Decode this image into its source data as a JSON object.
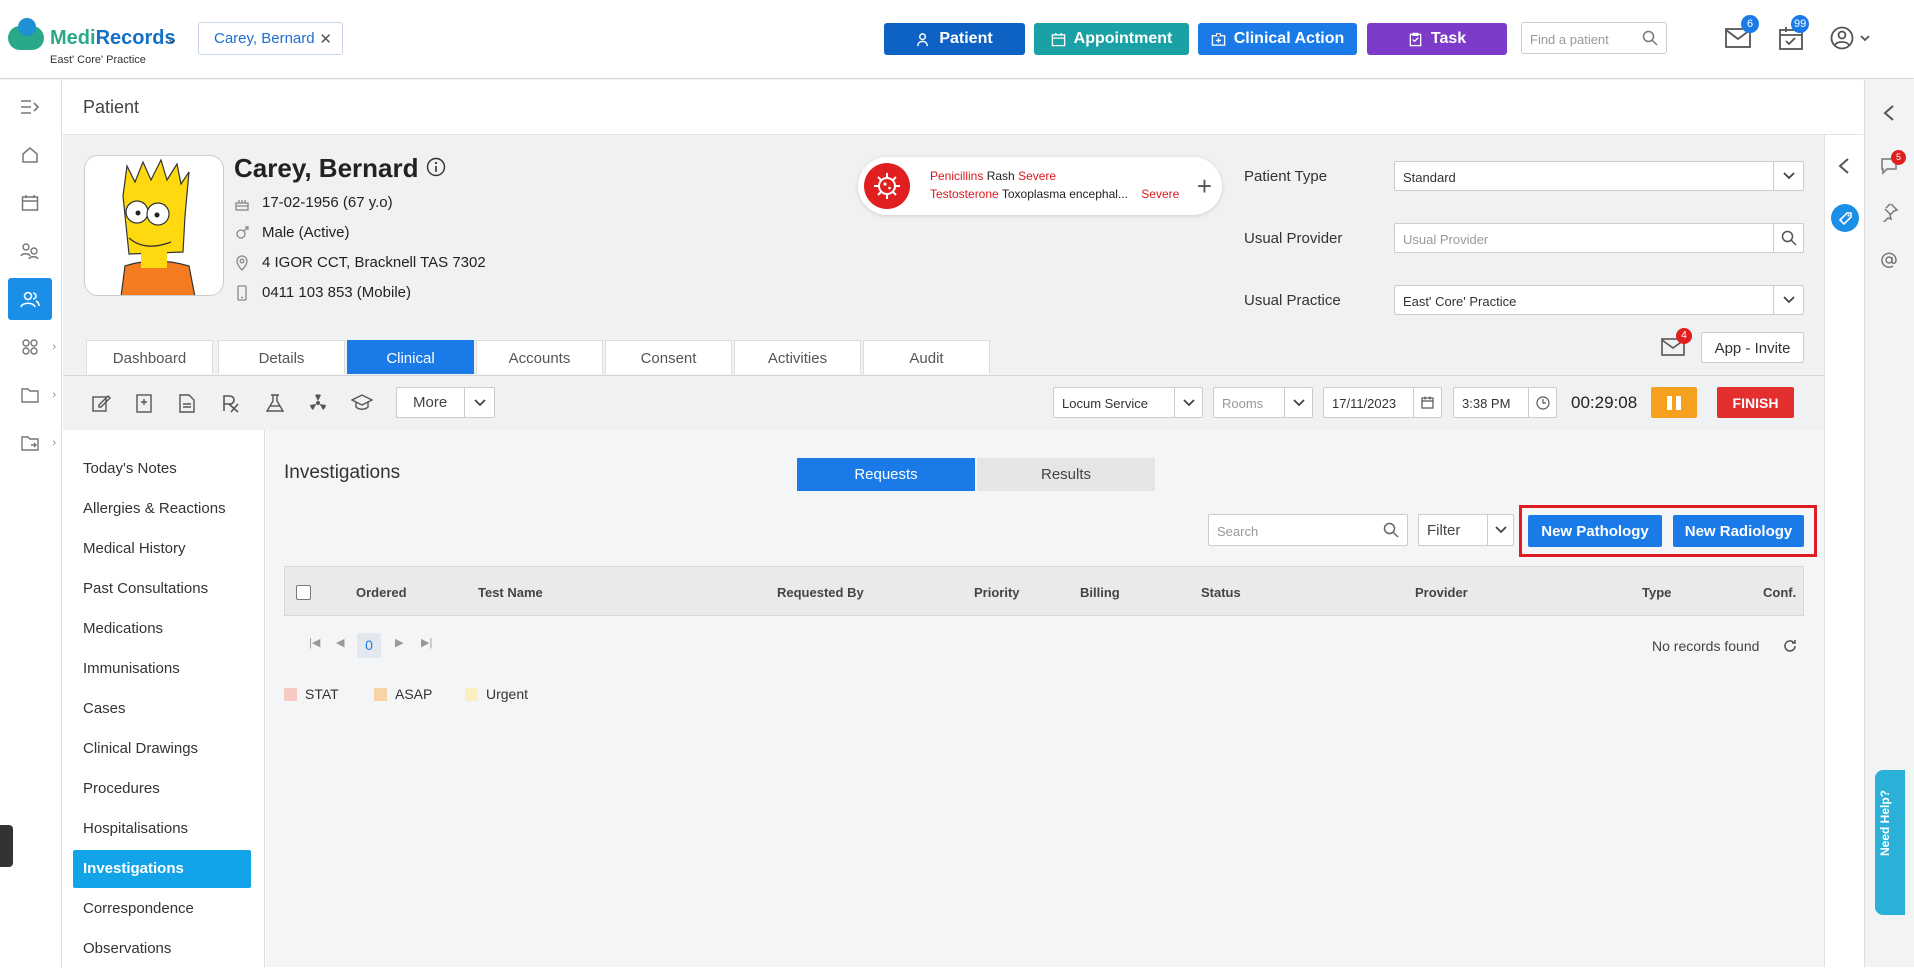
{
  "app": {
    "logo_part1": "Medi",
    "logo_part2": "Records",
    "practice": "East' Core' Practice"
  },
  "open_patient_chip": "Carey, Bernard",
  "top_buttons": {
    "patient": "Patient",
    "appointment": "Appointment",
    "clinical_action": "Clinical Action",
    "task": "Task"
  },
  "find_patient": {
    "placeholder": "Find a patient"
  },
  "badges": {
    "mail": "6",
    "calendar": "99",
    "side_chat": "5",
    "app_mail": "4"
  },
  "page_title": "Patient",
  "patient": {
    "name": "Carey, Bernard",
    "dob": "17-02-1956 (67 y.o)",
    "gender": "Male (Active)",
    "address": "4 IGOR CCT, Bracknell TAS 7302",
    "phone": "0411 103 853 (Mobile)"
  },
  "allergies": [
    {
      "substance": "Penicillins",
      "reaction": "Rash",
      "severity": "Severe"
    },
    {
      "substance": "Testosterone",
      "reaction": "Toxoplasma encephal...",
      "severity": "Severe"
    }
  ],
  "fields": {
    "patient_type_label": "Patient Type",
    "patient_type_value": "Standard",
    "usual_provider_label": "Usual Provider",
    "usual_provider_placeholder": "Usual Provider",
    "usual_practice_label": "Usual Practice",
    "usual_practice_value": "East' Core' Practice"
  },
  "tabs": [
    "Dashboard",
    "Details",
    "Clinical",
    "Accounts",
    "Consent",
    "Activities",
    "Audit"
  ],
  "app_invite": "App - Invite",
  "toolbar": {
    "more": "More",
    "service": "Locum Service",
    "rooms": "Rooms",
    "date": "17/11/2023",
    "time": "3:38 PM",
    "timer": "00:29:08",
    "finish": "FINISH"
  },
  "side_menu": [
    "Today's Notes",
    "Allergies & Reactions",
    "Medical History",
    "Past Consultations",
    "Medications",
    "Immunisations",
    "Cases",
    "Clinical Drawings",
    "Procedures",
    "Hospitalisations",
    "Investigations",
    "Correspondence",
    "Observations"
  ],
  "investigations": {
    "title": "Investigations",
    "segments": {
      "requests": "Requests",
      "results": "Results"
    },
    "search_placeholder": "Search",
    "filter": "Filter",
    "new_pathology": "New Pathology",
    "new_radiology": "New Radiology",
    "columns": [
      "Ordered",
      "Test Name",
      "Requested By",
      "Priority",
      "Billing",
      "Status",
      "Provider",
      "Type",
      "Conf."
    ],
    "page": "0",
    "no_records": "No records found",
    "legend": [
      {
        "label": "STAT",
        "color": "#f6c9c4"
      },
      {
        "label": "ASAP",
        "color": "#f8d3a6"
      },
      {
        "label": "Urgent",
        "color": "#fbeec0"
      }
    ]
  },
  "need_help": "Need Help?",
  "colors": {
    "primary": "#1a7be8",
    "patient_btn": "#0d62c4",
    "appointment_btn": "#1aa1a6",
    "clinical_btn": "#1a7be8",
    "task_btn": "#7d3bc9",
    "highlight": "#e01b24"
  }
}
